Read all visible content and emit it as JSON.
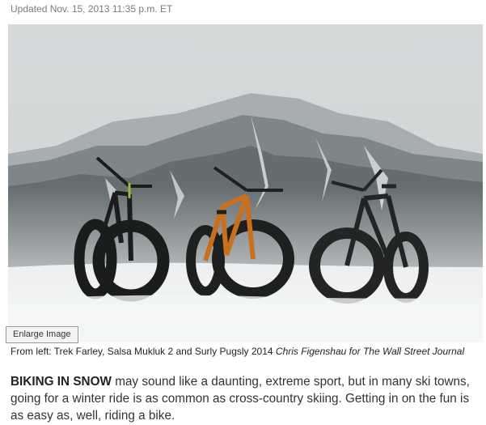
{
  "article": {
    "updated": "Updated Nov. 15, 2013 11:35 p.m. ET"
  },
  "photo": {
    "enlarge_label": "Enlarge Image",
    "caption": "From left: Trek Farley, Salsa Mukluk 2 and Surly Pugsly 2014",
    "credit": "Chris Figenshau for The Wall Street Journal",
    "bike_colors": [
      "#1a1d1b",
      "#c8701e",
      "#232525"
    ]
  },
  "body": {
    "lead": "BIKING IN SNOW",
    "text": "may sound like a daunting, extreme sport, but in many ski towns, going for a winter ride is as common as cross-country skiing. Getting in on the fun is as easy as, well, riding a bike."
  }
}
